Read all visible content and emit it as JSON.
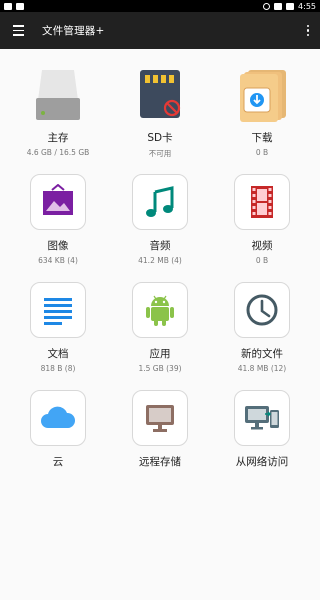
{
  "status": {
    "time": "4:55"
  },
  "appbar": {
    "title": "文件管理器+"
  },
  "tiles": [
    {
      "label": "主存",
      "sub": "4.6 GB / 16.5 GB"
    },
    {
      "label": "SD卡",
      "sub": "不可用"
    },
    {
      "label": "下载",
      "sub": "0 B"
    },
    {
      "label": "图像",
      "sub": "634 KB (4)"
    },
    {
      "label": "音频",
      "sub": "41.2 MB (4)"
    },
    {
      "label": "视频",
      "sub": "0 B"
    },
    {
      "label": "文档",
      "sub": "818 B (8)"
    },
    {
      "label": "应用",
      "sub": "1.5 GB (39)"
    },
    {
      "label": "新的文件",
      "sub": "41.8 MB (12)"
    },
    {
      "label": "云",
      "sub": ""
    },
    {
      "label": "远程存储",
      "sub": ""
    },
    {
      "label": "从网络访问",
      "sub": ""
    }
  ],
  "icons": [
    "drive-icon",
    "sd-card-icon",
    "download-folder-icon",
    "image-icon",
    "music-note-icon",
    "film-icon",
    "document-icon",
    "android-icon",
    "clock-icon",
    "cloud-icon",
    "monitor-icon",
    "network-devices-icon"
  ]
}
